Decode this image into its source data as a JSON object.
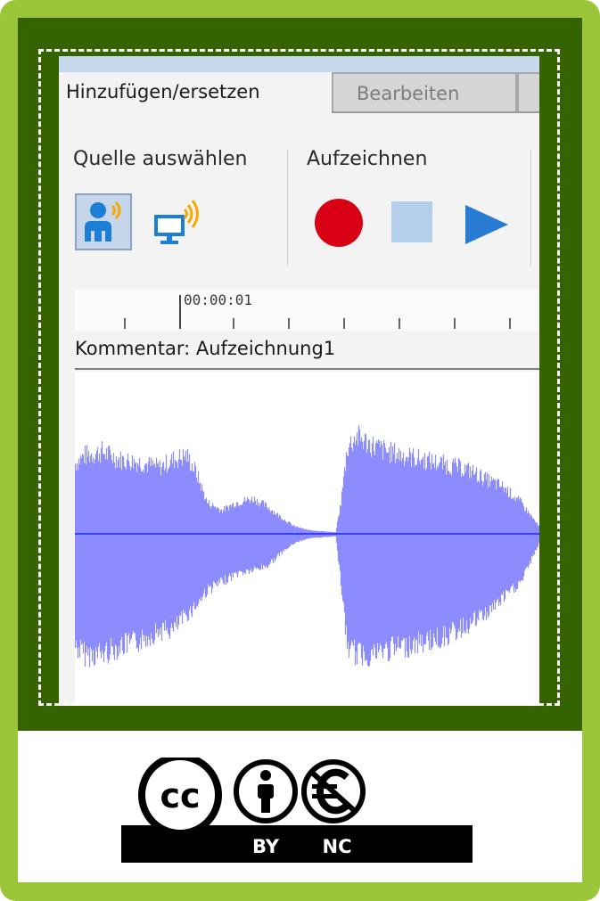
{
  "colors": {
    "outer_frame": "#9ac73a",
    "dark_panel": "#356300",
    "waveform": "#8c8cff",
    "waveform_centerline": "#3c3cff",
    "record": "#d90016",
    "stop": "#b3cfea",
    "play": "#2a7bd2",
    "icon_blue": "#1d7ed6",
    "signal_orange": "#f6a800"
  },
  "tabs": [
    {
      "label": "Hinzufügen/ersetzen",
      "active": true
    },
    {
      "label": "Bearbeiten",
      "active": false
    }
  ],
  "source_group": {
    "label": "Quelle auswählen",
    "buttons": [
      {
        "icon": "microphone-person-icon",
        "selected": true
      },
      {
        "icon": "computer-audio-icon",
        "selected": false
      }
    ]
  },
  "record_group": {
    "label": "Aufzeichnen",
    "buttons": [
      {
        "icon": "record-icon"
      },
      {
        "icon": "stop-icon"
      },
      {
        "icon": "play-icon"
      }
    ]
  },
  "timeline": {
    "time_label": "00:00:01"
  },
  "track": {
    "label": "Kommentar: Aufzeichnung1"
  },
  "license": {
    "cc": "cc",
    "by": "BY",
    "nc": "NC"
  }
}
